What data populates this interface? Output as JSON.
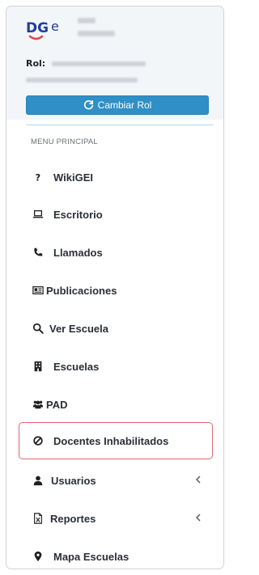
{
  "brand": {
    "logo_text": "DGE"
  },
  "role": {
    "label": "Rol:",
    "change_button": "Cambiar Rol"
  },
  "menu": {
    "header": "MENU PRINCIPAL",
    "items": [
      {
        "label": "WikiGEI",
        "icon": "question-icon"
      },
      {
        "label": "Escritorio",
        "icon": "laptop-icon"
      },
      {
        "label": "Llamados",
        "icon": "phone-icon"
      },
      {
        "label": "Publicaciones",
        "icon": "newspaper-icon"
      },
      {
        "label": "Ver Escuela",
        "icon": "search-icon"
      },
      {
        "label": "Escuelas",
        "icon": "building-icon"
      },
      {
        "label": "PAD",
        "icon": "users-icon"
      },
      {
        "label": "Docentes Inhabilitados",
        "icon": "ban-icon"
      },
      {
        "label": "Usuarios",
        "icon": "user-icon"
      },
      {
        "label": "Reportes",
        "icon": "file-excel-icon"
      },
      {
        "label": "Mapa Escuelas",
        "icon": "map-marker-icon"
      }
    ]
  },
  "colors": {
    "button": "#2f8fc6",
    "active_border": "#e06670",
    "panel_bg": "#f3f6f9"
  }
}
